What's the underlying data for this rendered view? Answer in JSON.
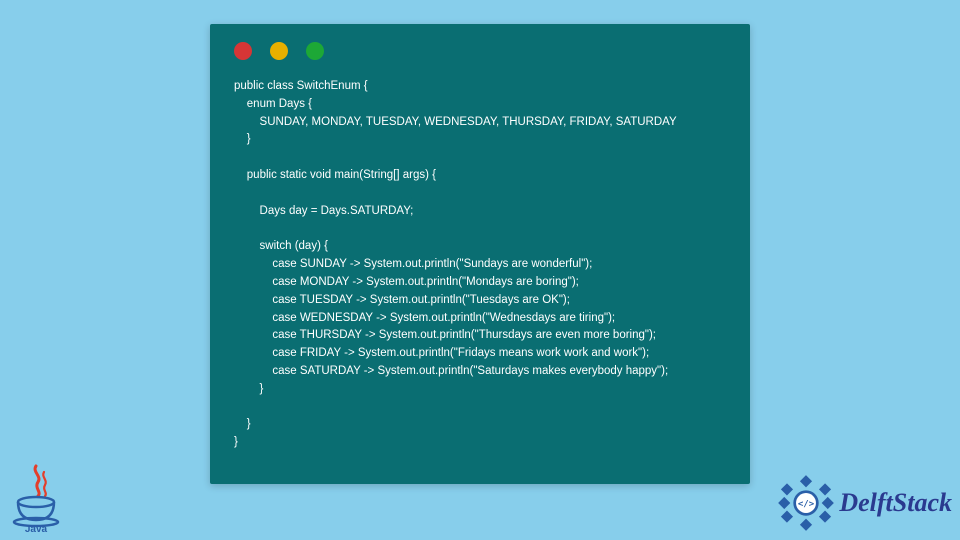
{
  "code": {
    "lines": "public class SwitchEnum {\n    enum Days {\n        SUNDAY, MONDAY, TUESDAY, WEDNESDAY, THURSDAY, FRIDAY, SATURDAY\n    }\n\n    public static void main(String[] args) {\n\n        Days day = Days.SATURDAY;\n\n        switch (day) {\n            case SUNDAY -> System.out.println(\"Sundays are wonderful\");\n            case MONDAY -> System.out.println(\"Mondays are boring\");\n            case TUESDAY -> System.out.println(\"Tuesdays are OK\");\n            case WEDNESDAY -> System.out.println(\"Wednesdays are tiring\");\n            case THURSDAY -> System.out.println(\"Thursdays are even more boring\");\n            case FRIDAY -> System.out.println(\"Fridays means work work and work\");\n            case SATURDAY -> System.out.println(\"Saturdays makes everybody happy\");\n        }\n\n    }\n}"
  },
  "logos": {
    "java_label": "Java",
    "delft_label": "DelftStack"
  },
  "colors": {
    "bg": "#87ceeb",
    "window": "#0a6e72",
    "red": "#d63636",
    "yellow": "#e8b000",
    "green": "#1da836",
    "delft_blue": "#2a3a8f"
  }
}
